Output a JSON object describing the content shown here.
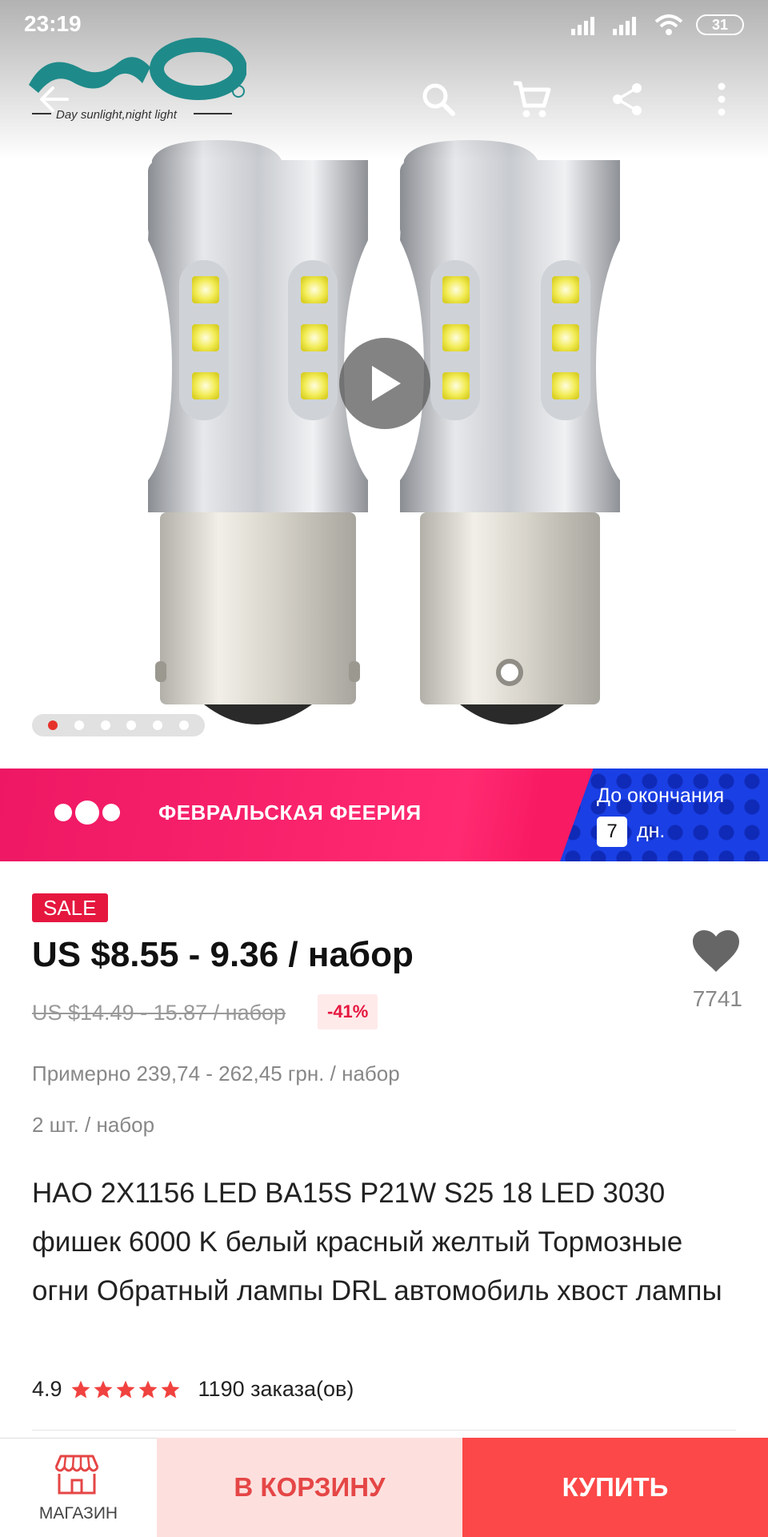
{
  "status_bar": {
    "time": "23:19",
    "battery": "31"
  },
  "brand": {
    "tagline": "Day sunlight,night light"
  },
  "icons": {
    "back": "back-arrow-icon",
    "search": "search-icon",
    "cart": "cart-icon",
    "share": "share-icon",
    "more": "more-vertical-icon",
    "play": "play-icon",
    "favorite": "heart-icon",
    "shop": "store-icon"
  },
  "gallery": {
    "total_images": 6,
    "active_index": 0
  },
  "promo": {
    "title": "ФЕВРАЛЬСКАЯ ФЕЕРИЯ",
    "until_label": "До окончания",
    "days": "7",
    "days_unit": "дн."
  },
  "product": {
    "badge": "SALE",
    "price": "US $8.55 - 9.36 / набор",
    "old_price": "US $14.49 - 15.87 / набор",
    "discount": "-41%",
    "wishlist_count": "7741",
    "approx_price": "Примерно 239,74 - 262,45 грн. / набор",
    "pack_info": "2 шт. / набор",
    "title": "HAO 2X1156 LED BA15S P21W S25 18 LED 3030 фишек 6000 K белый красный желтый Тормозные огни Обратный лампы DRL автомобиль хвост лампы",
    "rating": "4.9",
    "stars": 5,
    "orders": "1190 заказа(ов)"
  },
  "bottom_bar": {
    "shop_label": "МАГАЗИН",
    "cart_label": "В КОРЗИНУ",
    "buy_label": "КУПИТЬ"
  },
  "colors": {
    "accent_red": "#fc4848",
    "sale_red": "#e5173f",
    "promo_pink": "#ff2a71",
    "promo_blue": "#1a3fe4",
    "brand_teal": "#1f8a8a"
  }
}
